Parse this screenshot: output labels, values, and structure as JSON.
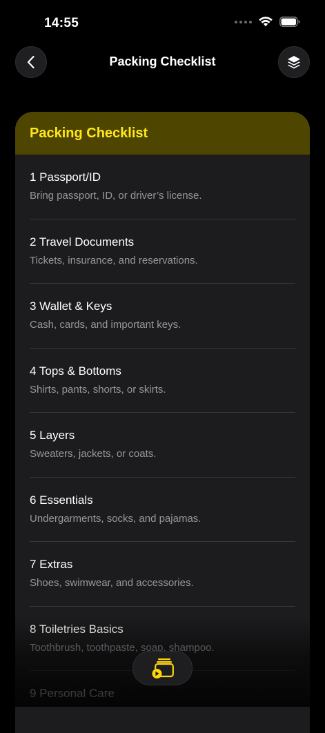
{
  "status_bar": {
    "time": "14:55"
  },
  "nav": {
    "title": "Packing Checklist",
    "back_icon": "chevron-left-icon",
    "layers_icon": "layers-icon"
  },
  "card": {
    "title": "Packing Checklist",
    "header_color": "#4d4500",
    "title_color": "#ffe81a",
    "items": [
      {
        "title": "1 Passport/ID",
        "desc": "Bring passport, ID, or driver’s license."
      },
      {
        "title": "2 Travel Documents",
        "desc": "Tickets, insurance, and reservations."
      },
      {
        "title": "3 Wallet & Keys",
        "desc": "Cash, cards, and important keys."
      },
      {
        "title": "4 Tops & Bottoms",
        "desc": "Shirts, pants, shorts, or skirts."
      },
      {
        "title": "5 Layers",
        "desc": "Sweaters, jackets, or coats."
      },
      {
        "title": "6 Essentials",
        "desc": "Undergarments, socks, and pajamas."
      },
      {
        "title": "7 Extras",
        "desc": "Shoes, swimwear, and accessories."
      },
      {
        "title": "8 Toiletries Basics",
        "desc": "Toothbrush, toothpaste, soap, shampoo."
      },
      {
        "title": "9 Personal Care",
        "desc": ""
      }
    ]
  },
  "fab": {
    "icon": "media-stack-icon",
    "accent": "#ffd60a"
  }
}
